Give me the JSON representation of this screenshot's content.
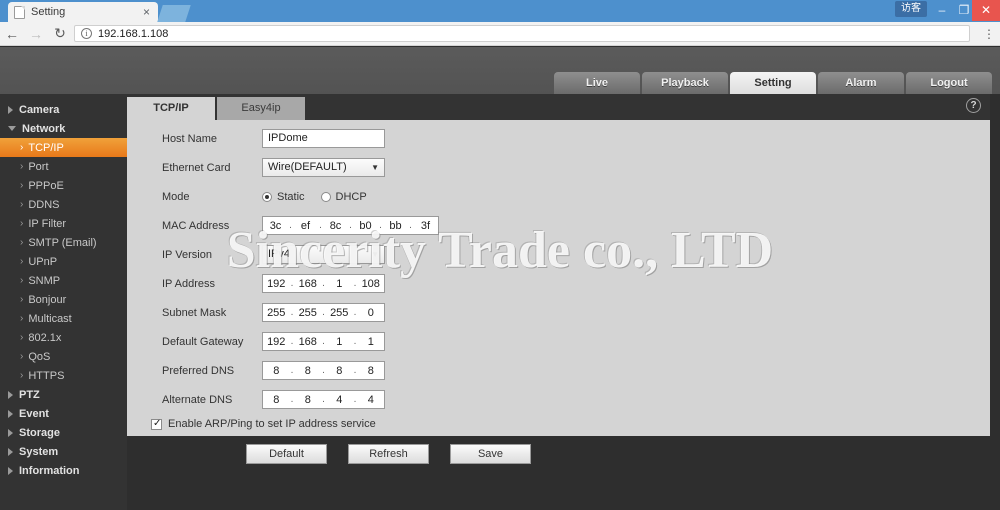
{
  "browser": {
    "tab_title": "Setting",
    "tab_close": "×",
    "back_icon": "←",
    "forward_icon": "→",
    "reload_icon": "↻",
    "info_icon": "i",
    "url": "192.168.1.108",
    "menu_icon": "⋮",
    "guest_badge": "访客",
    "minimize": "–",
    "maximize": "❐",
    "close": "✕"
  },
  "topnav": {
    "items": [
      {
        "label": "Live",
        "active": false
      },
      {
        "label": "Playback",
        "active": false
      },
      {
        "label": "Setting",
        "active": true
      },
      {
        "label": "Alarm",
        "active": false
      },
      {
        "label": "Logout",
        "active": false
      }
    ]
  },
  "sidebar": {
    "groups": [
      {
        "label": "Camera",
        "expanded": false
      },
      {
        "label": "Network",
        "expanded": true
      }
    ],
    "network_items": [
      {
        "label": "TCP/IP",
        "active": true
      },
      {
        "label": "Port",
        "active": false
      },
      {
        "label": "PPPoE",
        "active": false
      },
      {
        "label": "DDNS",
        "active": false
      },
      {
        "label": "IP Filter",
        "active": false
      },
      {
        "label": "SMTP (Email)",
        "active": false
      },
      {
        "label": "UPnP",
        "active": false
      },
      {
        "label": "SNMP",
        "active": false
      },
      {
        "label": "Bonjour",
        "active": false
      },
      {
        "label": "Multicast",
        "active": false
      },
      {
        "label": "802.1x",
        "active": false
      },
      {
        "label": "QoS",
        "active": false
      },
      {
        "label": "HTTPS",
        "active": false
      }
    ],
    "bottom_groups": [
      {
        "label": "PTZ"
      },
      {
        "label": "Event"
      },
      {
        "label": "Storage"
      },
      {
        "label": "System"
      },
      {
        "label": "Information"
      }
    ],
    "chevron": "›"
  },
  "panel": {
    "tabs": [
      {
        "label": "TCP/IP",
        "active": true
      },
      {
        "label": "Easy4ip",
        "active": false
      }
    ],
    "help_icon": "?"
  },
  "form": {
    "host_name": {
      "label": "Host Name",
      "value": "IPDome"
    },
    "ethernet_card": {
      "label": "Ethernet Card",
      "value": "Wire(DEFAULT)",
      "caret": "▼"
    },
    "mode": {
      "label": "Mode",
      "static_label": "Static",
      "dhcp_label": "DHCP",
      "selected": "Static"
    },
    "mac_address": {
      "label": "MAC Address",
      "octets": [
        "3c",
        "ef",
        "8c",
        "b0",
        "bb",
        "3f"
      ]
    },
    "ip_version": {
      "label": "IP Version",
      "value": "IPv4",
      "caret": "▼"
    },
    "ip_address": {
      "label": "IP Address",
      "octets": [
        "192",
        "168",
        "1",
        "108"
      ]
    },
    "subnet_mask": {
      "label": "Subnet Mask",
      "octets": [
        "255",
        "255",
        "255",
        "0"
      ]
    },
    "default_gateway": {
      "label": "Default Gateway",
      "octets": [
        "192",
        "168",
        "1",
        "1"
      ]
    },
    "preferred_dns": {
      "label": "Preferred DNS",
      "octets": [
        "8",
        "8",
        "8",
        "8"
      ]
    },
    "alternate_dns": {
      "label": "Alternate DNS",
      "octets": [
        "8",
        "8",
        "4",
        "4"
      ]
    },
    "arp_ping": {
      "label": "Enable ARP/Ping to set IP address service",
      "checked": true
    },
    "buttons": [
      {
        "label": "Default"
      },
      {
        "label": "Refresh"
      },
      {
        "label": "Save"
      }
    ],
    "dot": "."
  },
  "watermark": {
    "text": "Sincerity Trade co., LTD"
  },
  "colors": {
    "accent_orange": "#e8791a",
    "browser_blue": "#4d90cd",
    "sidebar_dark": "#333333",
    "panel_gray": "#d4d4d4",
    "close_red": "#e8554e"
  }
}
